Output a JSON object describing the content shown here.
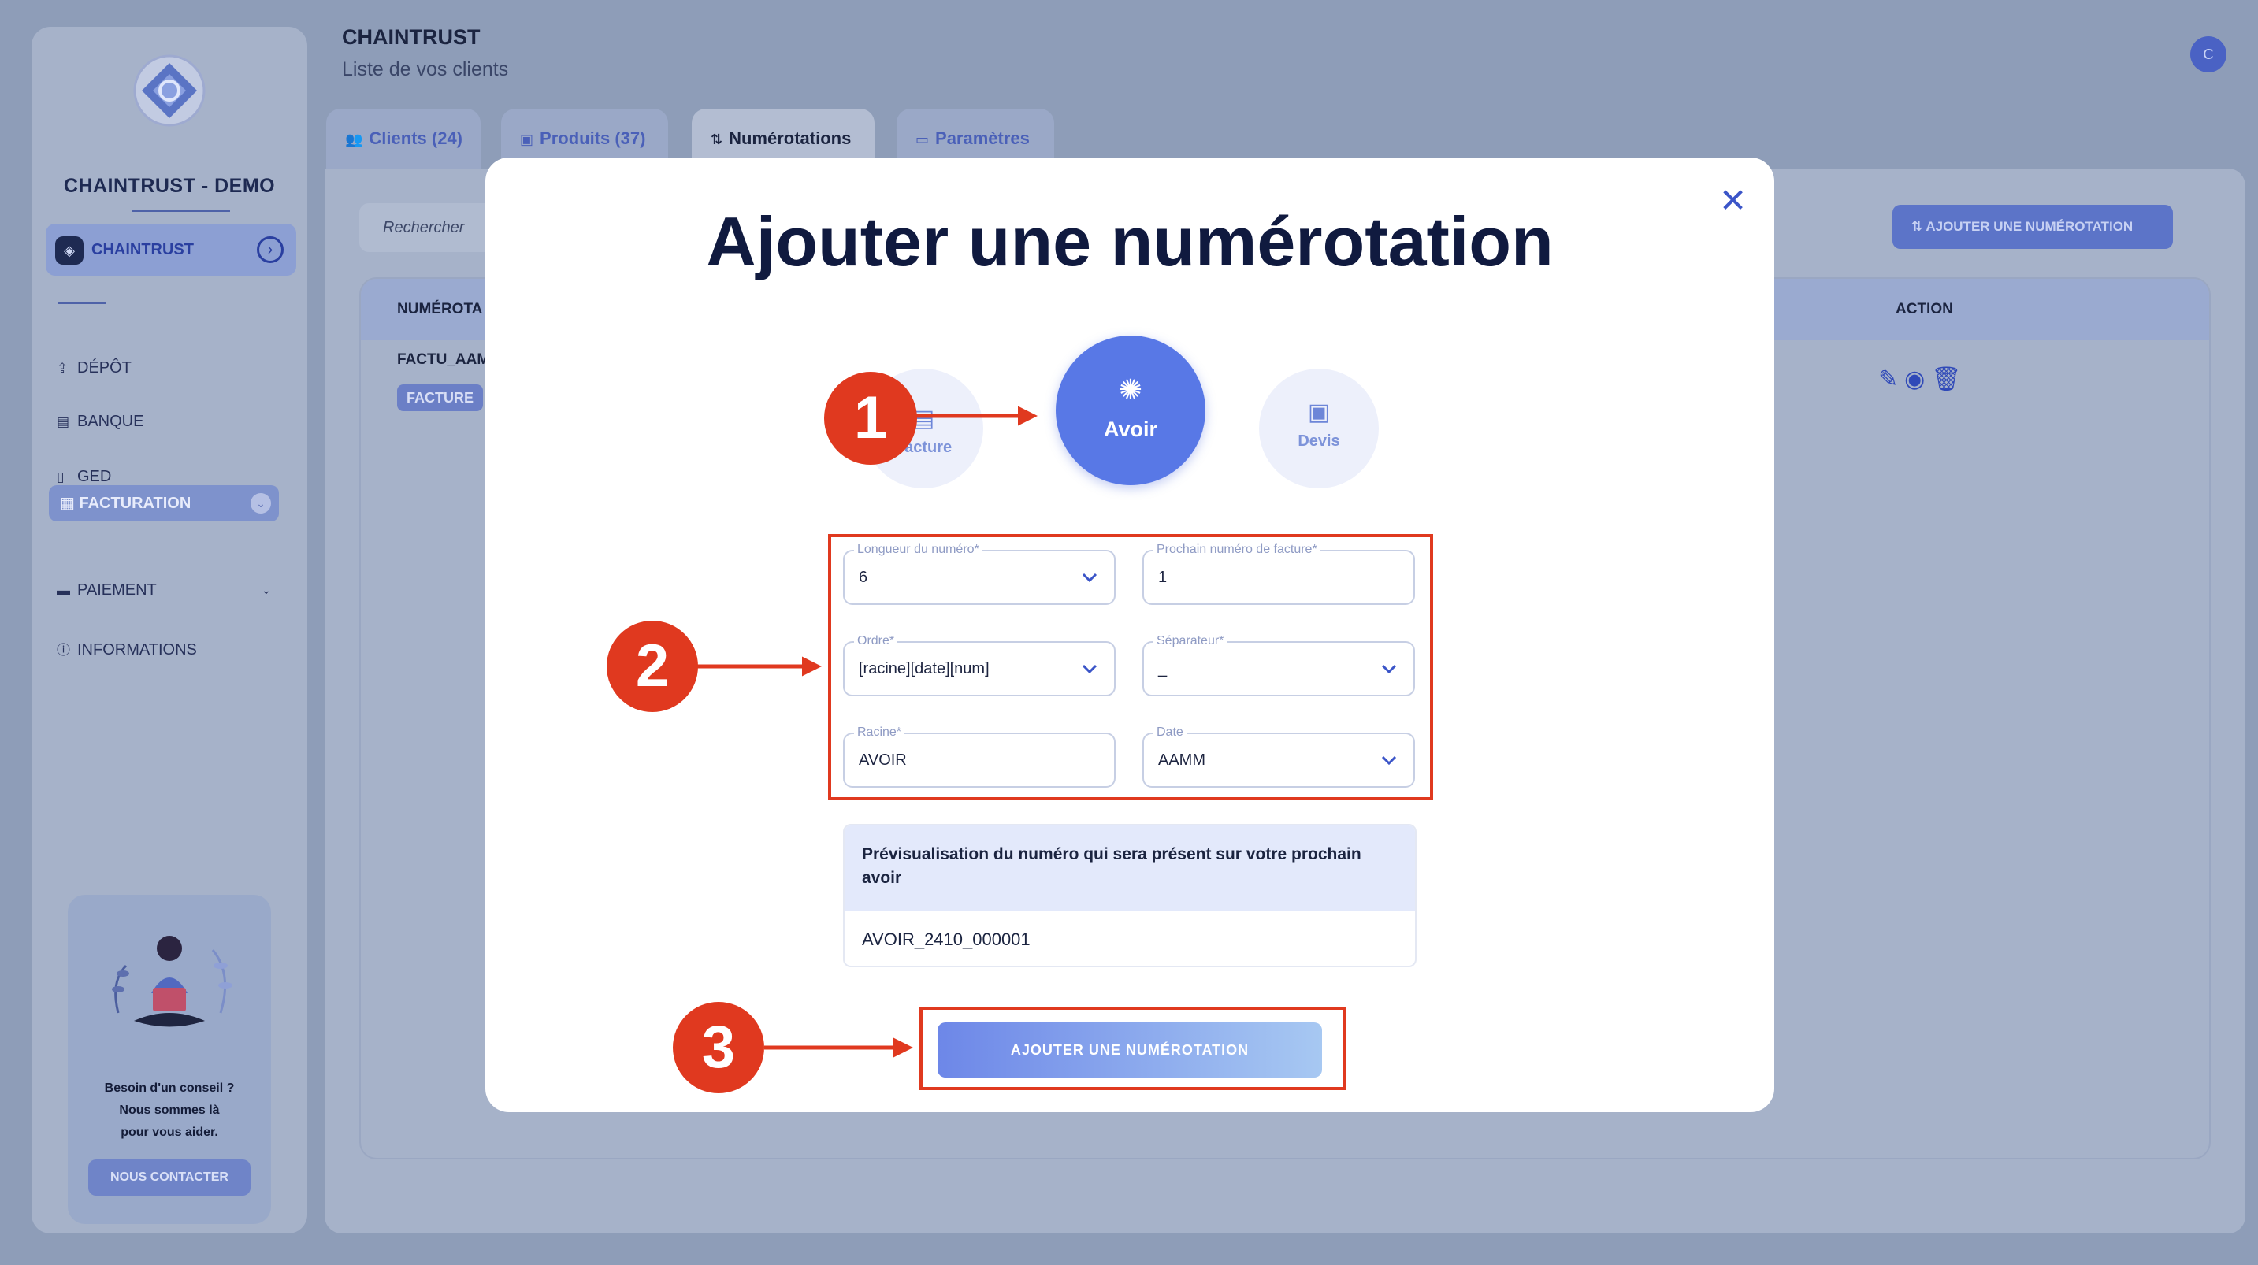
{
  "app": {
    "org_name": "CHAINTRUST - DEMO",
    "page_title": "CHAINTRUST",
    "page_subtitle": "Liste de vos clients",
    "avatar_initial": "C"
  },
  "sidebar": {
    "account_label": "CHAINTRUST",
    "items": [
      {
        "label": "DÉPÔT",
        "icon": "upload-icon"
      },
      {
        "label": "BANQUE",
        "icon": "bank-icon"
      },
      {
        "label": "GED",
        "icon": "document-icon"
      },
      {
        "label": "FACTURATION",
        "icon": "invoice-icon"
      },
      {
        "label": "PAIEMENT",
        "icon": "card-icon"
      },
      {
        "label": "INFORMATIONS",
        "icon": "info-icon"
      }
    ],
    "help": {
      "line1": "Besoin d'un conseil ?",
      "line2": "Nous sommes là",
      "line3": "pour vous aider.",
      "button": "NOUS CONTACTER"
    }
  },
  "tabs": [
    {
      "label": "Clients (24)",
      "icon": "users-icon"
    },
    {
      "label": "Produits (37)",
      "icon": "box-icon"
    },
    {
      "label": "Numérotations",
      "icon": "sort-icon",
      "active": true
    },
    {
      "label": "Paramètres",
      "icon": "settings-icon"
    }
  ],
  "toolbar": {
    "search_placeholder": "Rechercher",
    "add_button": "AJOUTER UNE NUMÉROTATION"
  },
  "table": {
    "headers": {
      "numero": "NUMÉROTA",
      "action": "ACTION"
    },
    "rows": [
      {
        "name": "FACTU_AAM",
        "badge": "FACTURE"
      }
    ]
  },
  "modal": {
    "title": "Ajouter une numérotation",
    "types": [
      {
        "label": "Facture",
        "icon": "receipt-icon"
      },
      {
        "label": "Avoir",
        "icon": "discount-badge-icon",
        "selected": true
      },
      {
        "label": "Devis",
        "icon": "clipboard-icon"
      }
    ],
    "fields": {
      "longueur": {
        "label": "Longueur du numéro*",
        "value": "6"
      },
      "prochain": {
        "label": "Prochain numéro de facture*",
        "value": "1"
      },
      "ordre": {
        "label": "Ordre*",
        "value": "[racine][date][num]"
      },
      "separateur": {
        "label": "Séparateur*",
        "value": "_"
      },
      "racine": {
        "label": "Racine*",
        "value": "AVOIR"
      },
      "date": {
        "label": "Date",
        "value": "AAMM"
      }
    },
    "preview": {
      "heading": "Prévisualisation du numéro qui sera présent sur votre prochain avoir",
      "value": "AVOIR_2410_000001"
    },
    "submit": "AJOUTER UNE NUMÉROTATION"
  },
  "annotations": {
    "step1": "1",
    "step2": "2",
    "step3": "3",
    "color": "#e0391f"
  },
  "colors": {
    "accent": "#5878e6",
    "title": "#101a3f"
  }
}
